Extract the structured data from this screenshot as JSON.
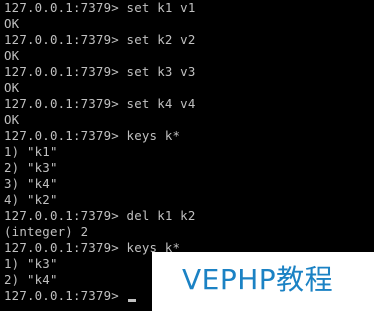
{
  "terminal": {
    "lines": [
      "127.0.0.1:7379> set k1 v1",
      "OK",
      "127.0.0.1:7379> set k2 v2",
      "OK",
      "127.0.0.1:7379> set k3 v3",
      "OK",
      "127.0.0.1:7379> set k4 v4",
      "OK",
      "127.0.0.1:7379> keys k*",
      "1) \"k1\"",
      "2) \"k3\"",
      "3) \"k4\"",
      "4) \"k2\"",
      "127.0.0.1:7379> del k1 k2",
      "(integer) 2",
      "127.0.0.1:7379> keys k*",
      "1) \"k3\"",
      "2) \"k4\"",
      "127.0.0.1:7379> "
    ],
    "background": "#000000",
    "foreground": "#c0c0c0"
  },
  "watermark": {
    "text": "VEPHP教程",
    "color": "#1b82c4"
  }
}
